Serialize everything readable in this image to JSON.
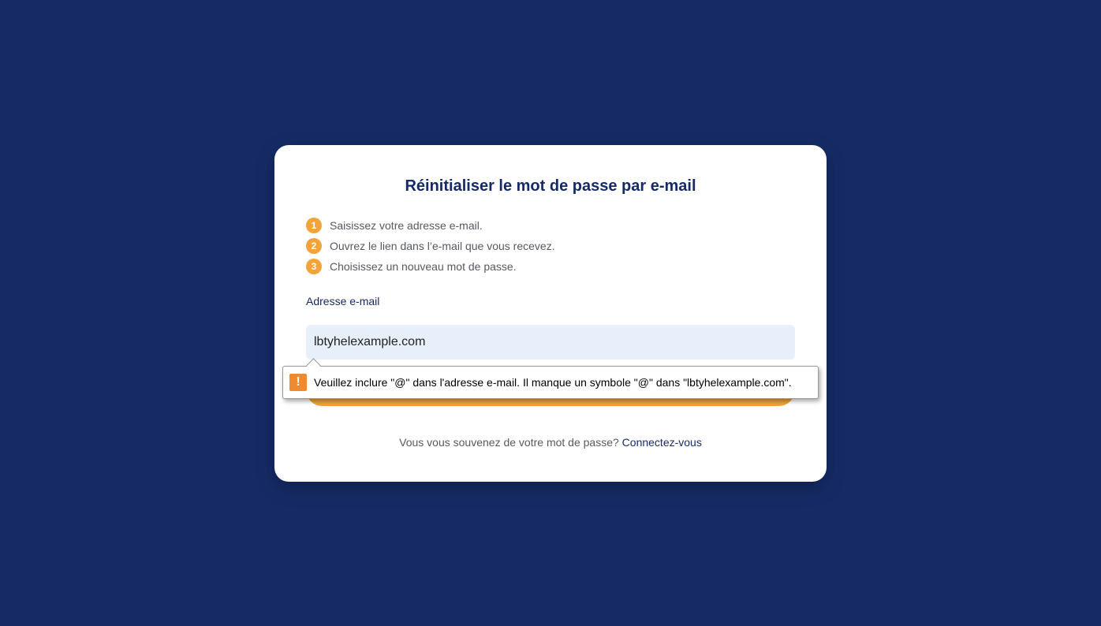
{
  "colors": {
    "background": "#162b66",
    "card": "#ffffff",
    "accent": "#f2a33a",
    "input_bg": "#e6effa",
    "warning": "#f08a30"
  },
  "card": {
    "title": "Réinitialiser le mot de passe par e-mail",
    "steps": [
      {
        "number": "1",
        "text": "Saisissez votre adresse e-mail."
      },
      {
        "number": "2",
        "text": "Ouvrez le lien dans l’e-mail que vous recevez."
      },
      {
        "number": "3",
        "text": "Choisissez un nouveau mot de passe."
      }
    ],
    "email_label": "Adresse e-mail",
    "email_value": "lbtyhelexample.com",
    "submit_label": "",
    "footer": {
      "text": "Vous vous souvenez de votre mot de passe?",
      "link": "Connectez-vous"
    }
  },
  "validation_tooltip": {
    "icon": "warning-icon",
    "icon_glyph": "!",
    "message": "Veuillez inclure \"@\" dans l'adresse e-mail. Il manque un symbole \"@\" dans \"lbtyhelexample.com\"."
  }
}
